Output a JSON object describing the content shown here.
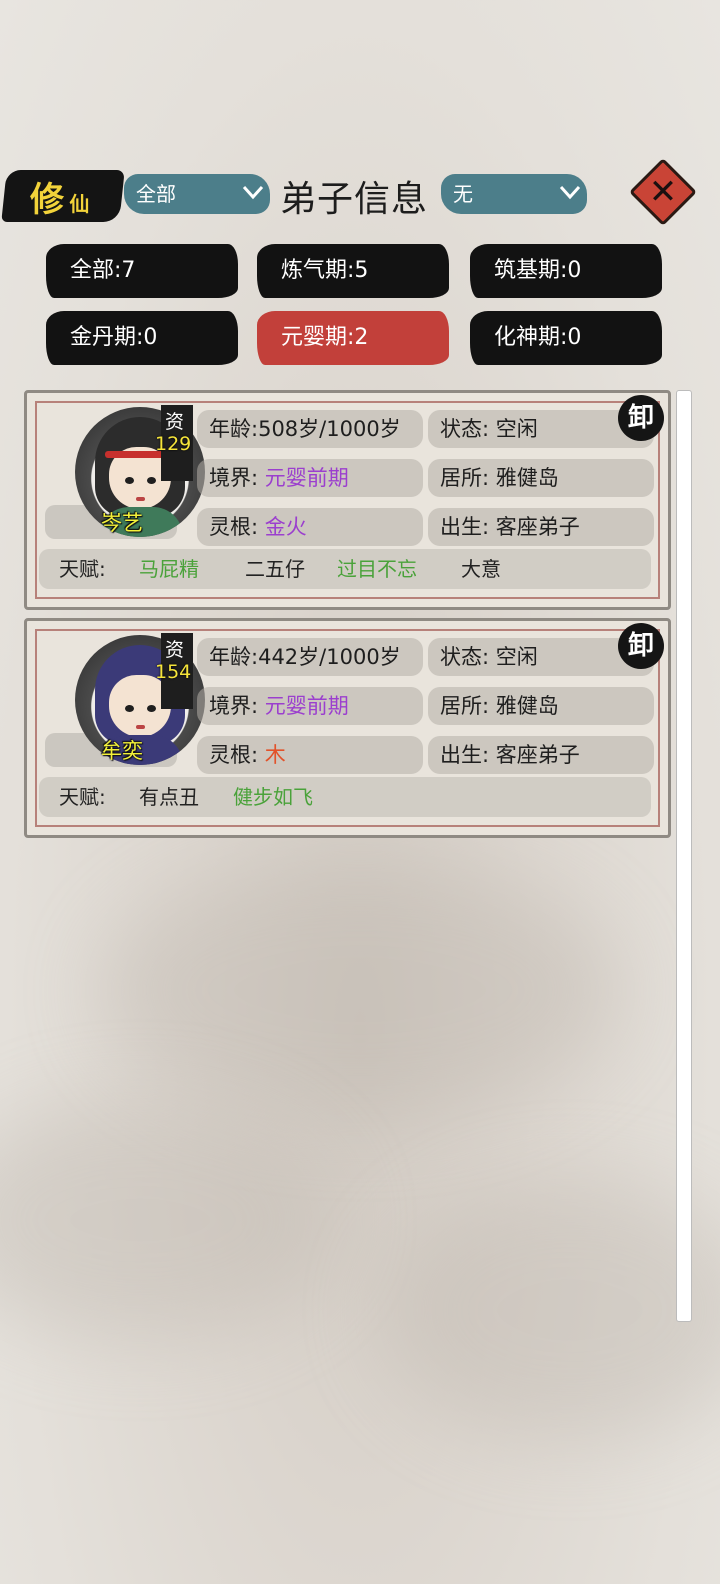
{
  "header": {
    "logo_big": "修",
    "logo_small": "仙",
    "filter_left": "全部",
    "title": "弟子信息",
    "filter_right": "无"
  },
  "filters": [
    {
      "label": "全部:7",
      "active": false
    },
    {
      "label": "炼气期:5",
      "active": false
    },
    {
      "label": "筑基期:0",
      "active": false
    },
    {
      "label": "金丹期:0",
      "active": false
    },
    {
      "label": "元婴期:2",
      "active": true
    },
    {
      "label": "化神期:0",
      "active": false
    }
  ],
  "labels": {
    "age": "年龄:",
    "status": "状态:",
    "realm": "境界:",
    "residence": "居所:",
    "root": "灵根:",
    "origin": "出生:",
    "talent": "天赋:",
    "aptitude": "资"
  },
  "disciples": [
    {
      "name": "岑艺",
      "aptitude": "129",
      "age": "508岁/1000岁",
      "status": "空闲",
      "realm": "元婴前期",
      "residence": "雅健岛",
      "root": "金火",
      "origin": "客座弟子",
      "badge": "卸",
      "talents": [
        {
          "text": "马屁精",
          "color": "#4aa23a"
        },
        {
          "text": "二五仔",
          "color": "#1e1e1e"
        },
        {
          "text": "过目不忘",
          "color": "#4aa23a"
        },
        {
          "text": "大意",
          "color": "#1e1e1e"
        }
      ]
    },
    {
      "name": "牟奕",
      "aptitude": "154",
      "age": "442岁/1000岁",
      "status": "空闲",
      "realm": "元婴前期",
      "residence": "雅健岛",
      "root": "木",
      "origin": "客座弟子",
      "badge": "卸",
      "talents": [
        {
          "text": "有点丑",
          "color": "#1e1e1e"
        },
        {
          "text": "健步如飞",
          "color": "#4aa23a"
        }
      ]
    }
  ],
  "colors": {
    "accent_red": "#c2403a",
    "dropdown_teal": "#4c7e8a",
    "realm_purple": "#9b3fce",
    "root_gold_purple": "#9b3fce",
    "root_wood_orange": "#e2522a"
  }
}
